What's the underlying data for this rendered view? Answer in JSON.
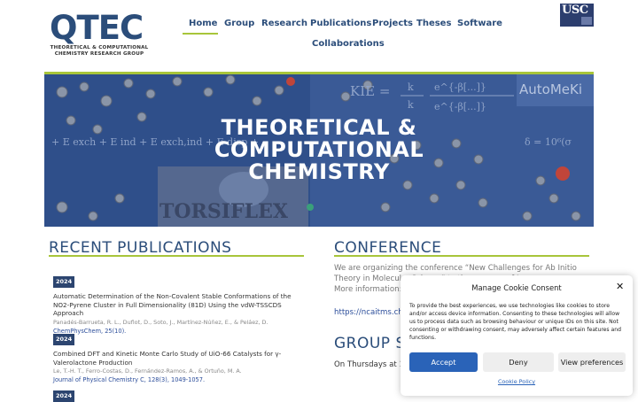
{
  "header": {
    "logo_word": "QTEC",
    "logo_sub1": "THEORETICAL & COMPUTATIONAL",
    "logo_sub2": "CHEMISTRY RESEARCH GROUP",
    "usc_logo": "USC"
  },
  "nav": {
    "items": [
      {
        "label": "Home"
      },
      {
        "label": "Group"
      },
      {
        "label": "Research"
      },
      {
        "label": "Publications"
      },
      {
        "label": "Projects"
      },
      {
        "label": "Theses"
      },
      {
        "label": "Software"
      },
      {
        "label": "Collaborations"
      }
    ],
    "active": "Home"
  },
  "hero": {
    "title_line1": "THEORETICAL &",
    "title_line2": "COMPUTATIONAL",
    "title_line3": "CHEMISTRY",
    "bg_formula_kie": "KIE = k^L / k^H",
    "bg_formula_sapt": "E^10_exch + E^20_ind + E^20_exch,ind + E^20_disp",
    "bg_formula_delta": "δ = 10^6 (σ_ref −",
    "bg_word_automeki": "AutoMeKi",
    "bg_word_torsiflex": "TORSIFLEX"
  },
  "recent_publications": {
    "heading": "RECENT PUBLICATIONS",
    "items": [
      {
        "year": "2024",
        "title": "Automatic Determination of the Non-Covalent Stable Conformations of the NO2-Pyrene Cluster in Full Dimensionality (81D) Using the vdW-TSSCDS Approach",
        "authors": "Panadés-Barrueta, R. L., Duflot, D., Soto, J., Martínez-Núñez, E., & Peláez, D.",
        "journal": "ChemPhysChem, 25(10)."
      },
      {
        "year": "2024",
        "title": "Combined DFT and Kinetic Monte Carlo Study of UiO-66 Catalysts for γ-Valerolactone Production",
        "authors": "Le, T.-H. T., Ferro-Costas, D., Fernández-Ramos, A., & Ortuño, M. A.",
        "journal": "Journal of Physical Chemistry C, 128(3), 1049-1057."
      },
      {
        "year": "2024"
      }
    ]
  },
  "conference": {
    "heading": "CONFERENCE",
    "text": "We are organizing the conference “New Challenges for Ab Initio Theory in Molecular Science” to the memory of I",
    "more_info_label": "More information:",
    "link": "https://ncaitms.che"
  },
  "group_seminars": {
    "heading": "GROUP S",
    "text": "On Thursdays at 1"
  },
  "cookie": {
    "title": "Manage Cookie Consent",
    "body": "To provide the best experiences, we use technologies like cookies to store and/or access device information. Consenting to these technologies will allow us to process data such as browsing behaviour or unique IDs on this site. Not consenting or withdrawing consent, may adversely affect certain features and functions.",
    "accept": "Accept",
    "deny": "Deny",
    "preferences": "View preferences",
    "policy": "Cookie Policy"
  },
  "colors": {
    "brand_blue": "#2b4d7a",
    "accent_green": "#a8c53a",
    "hero_blue": "#2f4f8a",
    "accept_blue": "#2a63b8"
  }
}
